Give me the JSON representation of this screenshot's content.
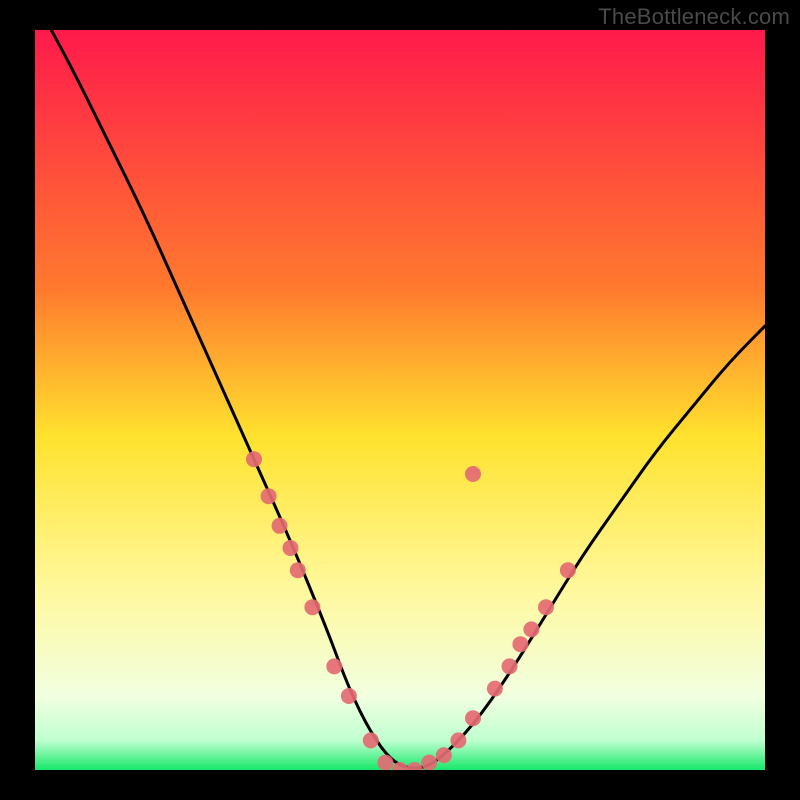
{
  "watermark": "TheBottleneck.com",
  "chart_data": {
    "type": "line",
    "title": "",
    "xlabel": "",
    "ylabel": "",
    "xlim": [
      0,
      100
    ],
    "ylim": [
      0,
      100
    ],
    "gradient_stops": [
      {
        "offset": 0,
        "color": "#ff1a4b"
      },
      {
        "offset": 35,
        "color": "#ff7a2e"
      },
      {
        "offset": 55,
        "color": "#ffe22e"
      },
      {
        "offset": 75,
        "color": "#fff89a"
      },
      {
        "offset": 90,
        "color": "#f2ffe0"
      },
      {
        "offset": 96,
        "color": "#bfffd0"
      },
      {
        "offset": 100,
        "color": "#17e86a"
      }
    ],
    "series": [
      {
        "name": "bottleneck-curve",
        "x": [
          0,
          5,
          10,
          15,
          20,
          25,
          30,
          35,
          40,
          43,
          46,
          49,
          52,
          55,
          60,
          65,
          70,
          75,
          80,
          85,
          90,
          95,
          100
        ],
        "y": [
          104,
          95,
          85,
          75,
          64,
          53,
          42,
          31,
          19,
          11,
          5,
          1,
          0,
          1,
          6,
          13,
          21,
          29,
          36,
          43,
          49,
          55,
          60
        ]
      }
    ],
    "markers": {
      "name": "highlight-dots",
      "color": "#e46a72",
      "radius": 8,
      "points": [
        {
          "x": 30,
          "y": 42
        },
        {
          "x": 32,
          "y": 37
        },
        {
          "x": 33.5,
          "y": 33
        },
        {
          "x": 35,
          "y": 30
        },
        {
          "x": 36,
          "y": 27
        },
        {
          "x": 38,
          "y": 22
        },
        {
          "x": 41,
          "y": 14
        },
        {
          "x": 43,
          "y": 10
        },
        {
          "x": 46,
          "y": 4
        },
        {
          "x": 48,
          "y": 1
        },
        {
          "x": 50,
          "y": 0
        },
        {
          "x": 52,
          "y": 0
        },
        {
          "x": 54,
          "y": 1
        },
        {
          "x": 56,
          "y": 2
        },
        {
          "x": 58,
          "y": 4
        },
        {
          "x": 60,
          "y": 7
        },
        {
          "x": 63,
          "y": 11
        },
        {
          "x": 65,
          "y": 14
        },
        {
          "x": 66.5,
          "y": 17
        },
        {
          "x": 68,
          "y": 19
        },
        {
          "x": 70,
          "y": 22
        },
        {
          "x": 73,
          "y": 27
        },
        {
          "x": 60,
          "y": 40
        }
      ]
    }
  }
}
